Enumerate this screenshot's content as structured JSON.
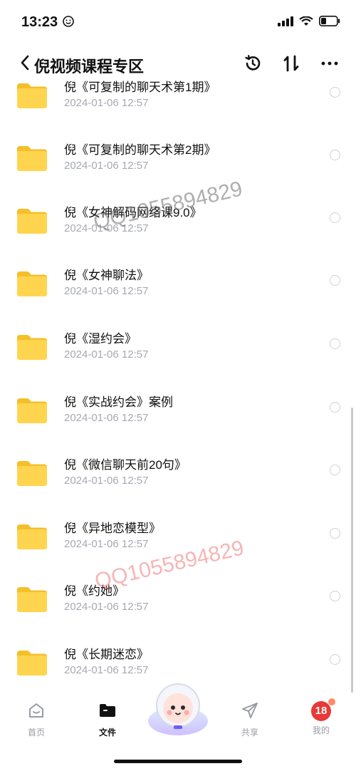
{
  "status_bar": {
    "time": "13:23"
  },
  "header": {
    "title": "倪视频课程专区"
  },
  "files": [
    {
      "name": "倪《可复制的聊天术第1期》",
      "date": "2024-01-06 12:57"
    },
    {
      "name": "倪《可复制的聊天术第2期》",
      "date": "2024-01-06 12:57"
    },
    {
      "name": "倪《女神解码网络课9.0》",
      "date": "2024-01-06 12:57"
    },
    {
      "name": "倪《女神聊法》",
      "date": "2024-01-06 12:57"
    },
    {
      "name": "倪《湿约会》",
      "date": "2024-01-06 12:57"
    },
    {
      "name": "倪《实战约会》案例",
      "date": "2024-01-06 12:57"
    },
    {
      "name": "倪《微信聊天前20句》",
      "date": "2024-01-06 12:57"
    },
    {
      "name": "倪《异地恋模型》",
      "date": "2024-01-06 12:57"
    },
    {
      "name": "倪《约她》",
      "date": "2024-01-06 12:57"
    },
    {
      "name": "倪《长期迷恋》",
      "date": "2024-01-06 12:57"
    }
  ],
  "watermarks": [
    "QQ1055894829",
    "QQ1055894829"
  ],
  "tabbar": {
    "home": "首页",
    "files": "文件",
    "share": "共享",
    "mine": "我的",
    "avatar_text": "18"
  },
  "colors": {
    "folder": "#ffd24d",
    "accent": "#e83838"
  }
}
